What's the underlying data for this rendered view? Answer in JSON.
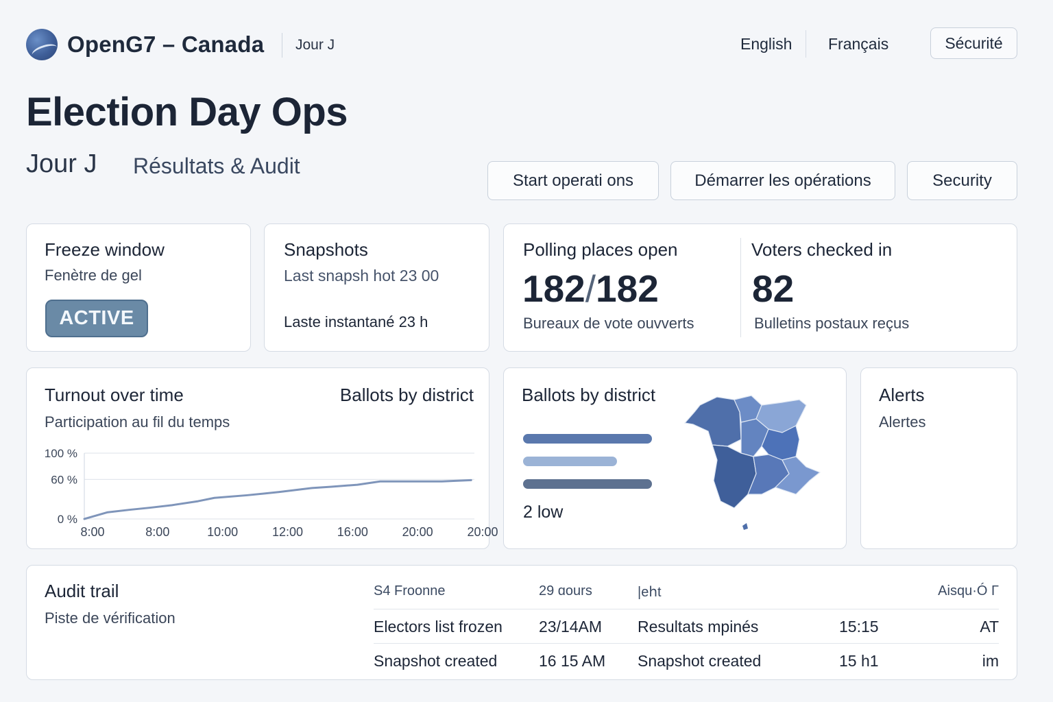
{
  "header": {
    "brand": "OpenG7 – Canada",
    "subtitle": "Jour J",
    "lang_en": "English",
    "lang_fr": "Français",
    "security_fr": "Sécurité"
  },
  "page": {
    "title": "Election Day Ops",
    "subtitle_jour": "Jour J",
    "subtitle_results": "Résultats & Audit"
  },
  "actions": {
    "start_en": "Start operati ons",
    "start_fr": "Démarrer les opérations",
    "security_en": "Security"
  },
  "freeze": {
    "title": "Freeze window",
    "subtitle": "Fenètre de gel",
    "status": "ACTIVE"
  },
  "snapshots": {
    "title": "Snapshots",
    "last_en": "Last snapsh hot 23 00",
    "last_fr": "Laste instantané 23 h"
  },
  "polling": {
    "title": "Polling places open",
    "value_open": "182",
    "value_total": "182",
    "subtitle": "Bureaux de vote ouvverts"
  },
  "voters": {
    "title": "Voters checked in",
    "value": "82",
    "subtitle": "Bulletins postaux reçus"
  },
  "turnout": {
    "title": "Turnout over time",
    "alt_title": "Ballots by district",
    "subtitle": "Participation au fil  du temps",
    "y_ticks": [
      "100 %",
      "60 %",
      "0 %"
    ],
    "x_ticks": [
      "8:00",
      "8:00",
      "10:00",
      "12:00",
      "16:00",
      "20:00",
      "20:00"
    ],
    "line_color": "#7f95ba"
  },
  "chart_data": {
    "type": "line",
    "title": "Turnout over time",
    "subtitle": "Participation au fil  du temps",
    "y_tick_labels": [
      "0 %",
      "60 %",
      "100 %"
    ],
    "y_tick_values": [
      0,
      60,
      100
    ],
    "x_tick_labels": [
      "8:00",
      "8:00",
      "10:00",
      "12:00",
      "16:00",
      "20:00",
      "20:00"
    ],
    "ylim": [
      0,
      100
    ],
    "grid": "horizontal",
    "series": [
      {
        "x": [
          0,
          0.35,
          0.7,
          1.0,
          1.35,
          1.75,
          2.0,
          2.5,
          3.0,
          3.5,
          3.8,
          4.2,
          4.55,
          5.0,
          5.5,
          5.95
        ],
        "y": [
          0,
          10,
          14,
          17,
          21,
          27,
          32,
          36,
          41,
          47,
          49,
          52,
          57,
          57,
          57,
          59
        ]
      }
    ]
  },
  "ballots": {
    "title": "Ballots by district",
    "bars": [
      {
        "fraction": 1.0,
        "color": "#5a78ad"
      },
      {
        "fraction": 0.73,
        "color": "#9bb3d6"
      },
      {
        "fraction": 1.0,
        "color": "#5d7190"
      }
    ],
    "caption": "2 low",
    "map_colors": [
      "#3f5f9a",
      "#4f6faa",
      "#6c8cc6",
      "#8aa6d6",
      "#5878b8",
      "#7a98cf"
    ]
  },
  "alerts": {
    "title": "Alerts",
    "subtitle": "Alertes"
  },
  "audit": {
    "title": "Audit trail",
    "subtitle": "Piste de vérification",
    "header": [
      "S4 Froonne",
      "29 ɑours",
      "|eհt",
      "",
      "Aisqu·Ó Γ"
    ],
    "rows": [
      [
        "Electors list frozen",
        "23/14AM",
        "Resultats mpinés",
        "15:15",
        "AT"
      ],
      [
        "Snapshot created",
        "16 15 AM",
        "Snapshot created",
        "15 h1",
        "im"
      ]
    ]
  }
}
